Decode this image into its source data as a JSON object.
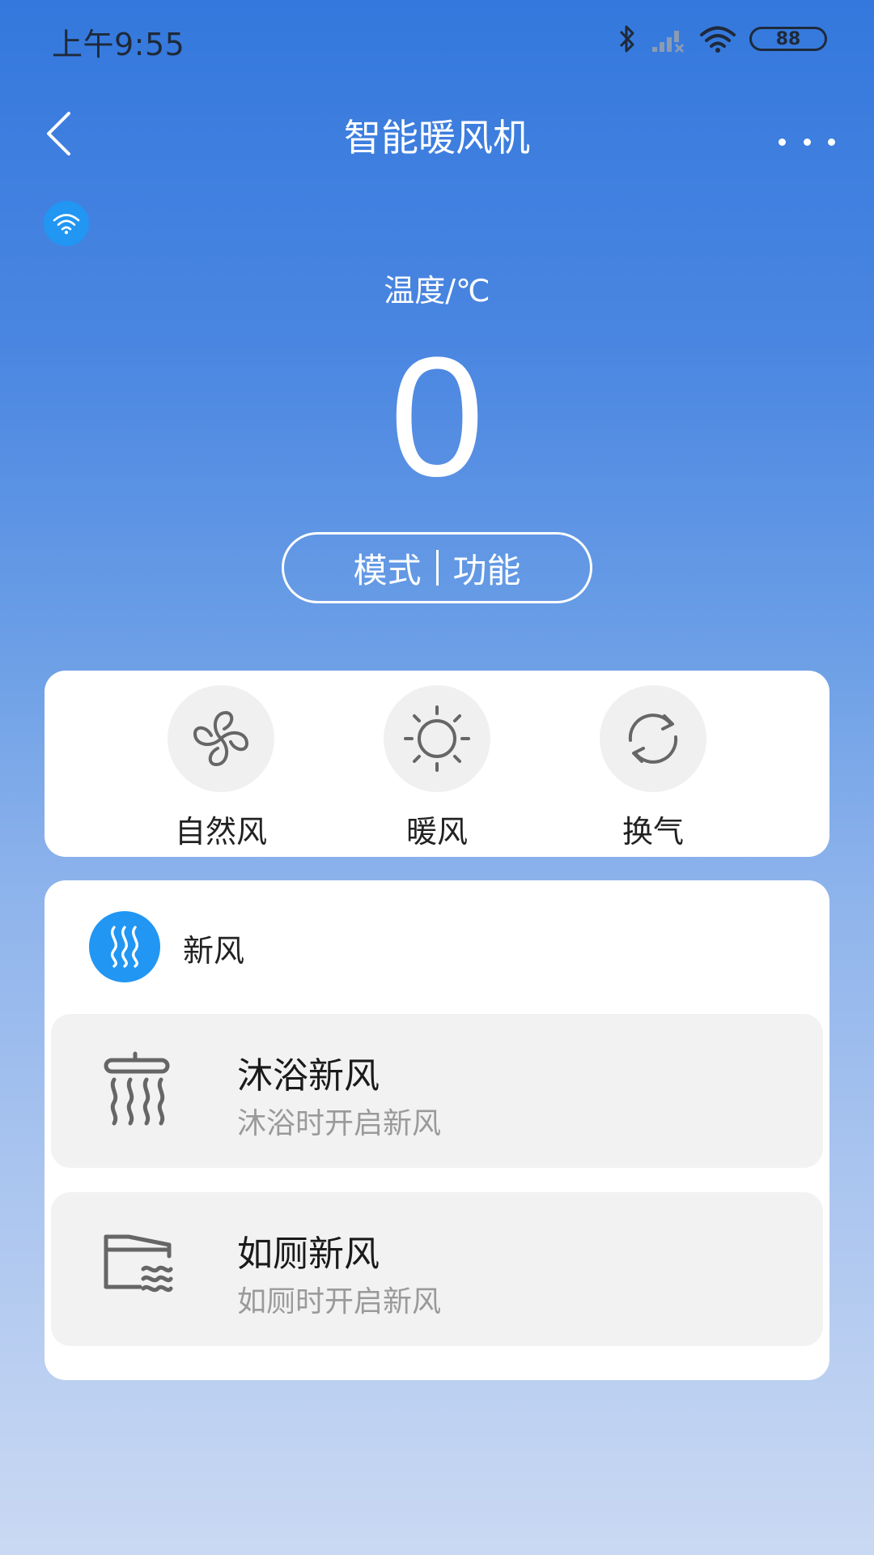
{
  "status_bar": {
    "time": "上午9:55",
    "battery": "88"
  },
  "header": {
    "title": "智能暖风机"
  },
  "temperature": {
    "label": "温度/℃",
    "value": "0"
  },
  "mode_function": {
    "mode_label": "模式",
    "function_label": "功能"
  },
  "modes": [
    {
      "label": "自然风",
      "icon": "fan-icon"
    },
    {
      "label": "暖风",
      "icon": "sun-icon"
    },
    {
      "label": "换气",
      "icon": "refresh-icon"
    }
  ],
  "fresh_air": {
    "title": "新风",
    "items": [
      {
        "title": "沐浴新风",
        "subtitle": "沐浴时开启新风",
        "icon": "shower-icon"
      },
      {
        "title": "如厕新风",
        "subtitle": "如厕时开启新风",
        "icon": "toilet-icon"
      }
    ]
  },
  "colors": {
    "accent": "#2196f3",
    "card": "#ffffff",
    "item_bg": "#f2f2f2"
  }
}
